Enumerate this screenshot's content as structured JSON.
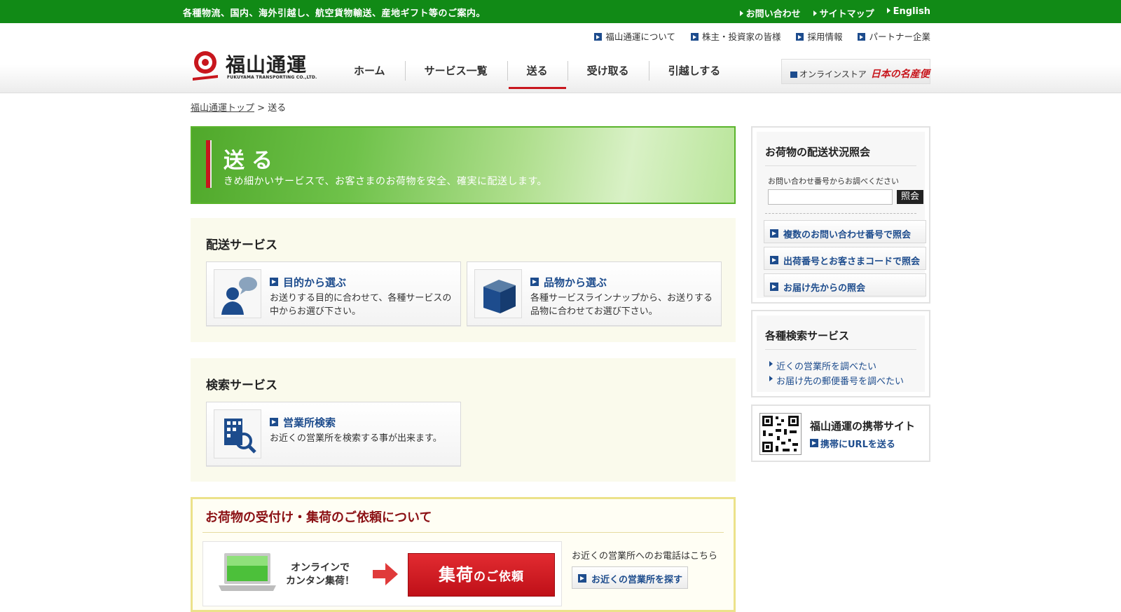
{
  "topbar": {
    "tagline": "各種物流、国内、海外引越し、航空貨物輸送、産地ギフト等のご案内。",
    "links": [
      "お問い合わせ",
      "サイトマップ",
      "English"
    ]
  },
  "header": {
    "sublinks": [
      "福山通運について",
      "株主・投資家の皆様",
      "採用情報",
      "パートナー企業"
    ],
    "logo_name": "福山通運",
    "logo_sub": "FUKUYAMA TRANSPORTING CO.,LTD.",
    "nav": [
      "ホーム",
      "サービス一覧",
      "送る",
      "受け取る",
      "引越しする"
    ],
    "active_nav": "送る",
    "store_label": "オンラインストア",
    "store_brand": "日本の名産便"
  },
  "breadcrumb": {
    "home": "福山通運トップ",
    "separator": ">",
    "current": "送る"
  },
  "hero": {
    "title": "送る",
    "subtitle": "きめ細かいサービスで、お客さまのお荷物を安全、確実に配送します。"
  },
  "delivery": {
    "heading": "配送サービス",
    "cards": [
      {
        "title": "目的から選ぶ",
        "desc": "お送りする目的に合わせて、各種サービスの中からお選び下さい。",
        "icon": "person-speech-icon"
      },
      {
        "title": "品物から選ぶ",
        "desc": "各種サービスラインナップから、お送りする品物に合わせてお選び下さい。",
        "icon": "box-icon"
      }
    ]
  },
  "search": {
    "heading": "検索サービス",
    "cards": [
      {
        "title": "営業所検索",
        "desc": "お近くの営業所を検索する事が出来ます。",
        "icon": "building-search-icon"
      }
    ]
  },
  "pickup": {
    "heading": "お荷物の受付け・集荷のご依頼について",
    "online_line1": "オンラインで",
    "online_line2": "カンタン集荷！",
    "request_main": "集荷",
    "request_small": "のご依頼",
    "phone_text": "お近くの営業所へのお電話はこちら",
    "find_button": "お近くの営業所を探す"
  },
  "sidebar": {
    "tracking": {
      "heading": "お荷物の配送状況照会",
      "note": "お問い合わせ番号からお調べください",
      "input_value": "",
      "button": "照会",
      "options": [
        "複数のお問い合わせ番号で照会",
        "出荷番号とお客さまコードで照会",
        "お届け先からの照会"
      ]
    },
    "searches": {
      "heading": "各種検索サービス",
      "links": [
        "近くの営業所を調べたい",
        "お届け先の郵便番号を調べたい"
      ]
    },
    "mobile": {
      "title": "福山通運の携帯サイト",
      "link": "携帯にURLを送る"
    }
  },
  "colors": {
    "brand_green": "#118a16",
    "accent_red": "#c8161d",
    "link_blue": "#1d4c8d"
  }
}
